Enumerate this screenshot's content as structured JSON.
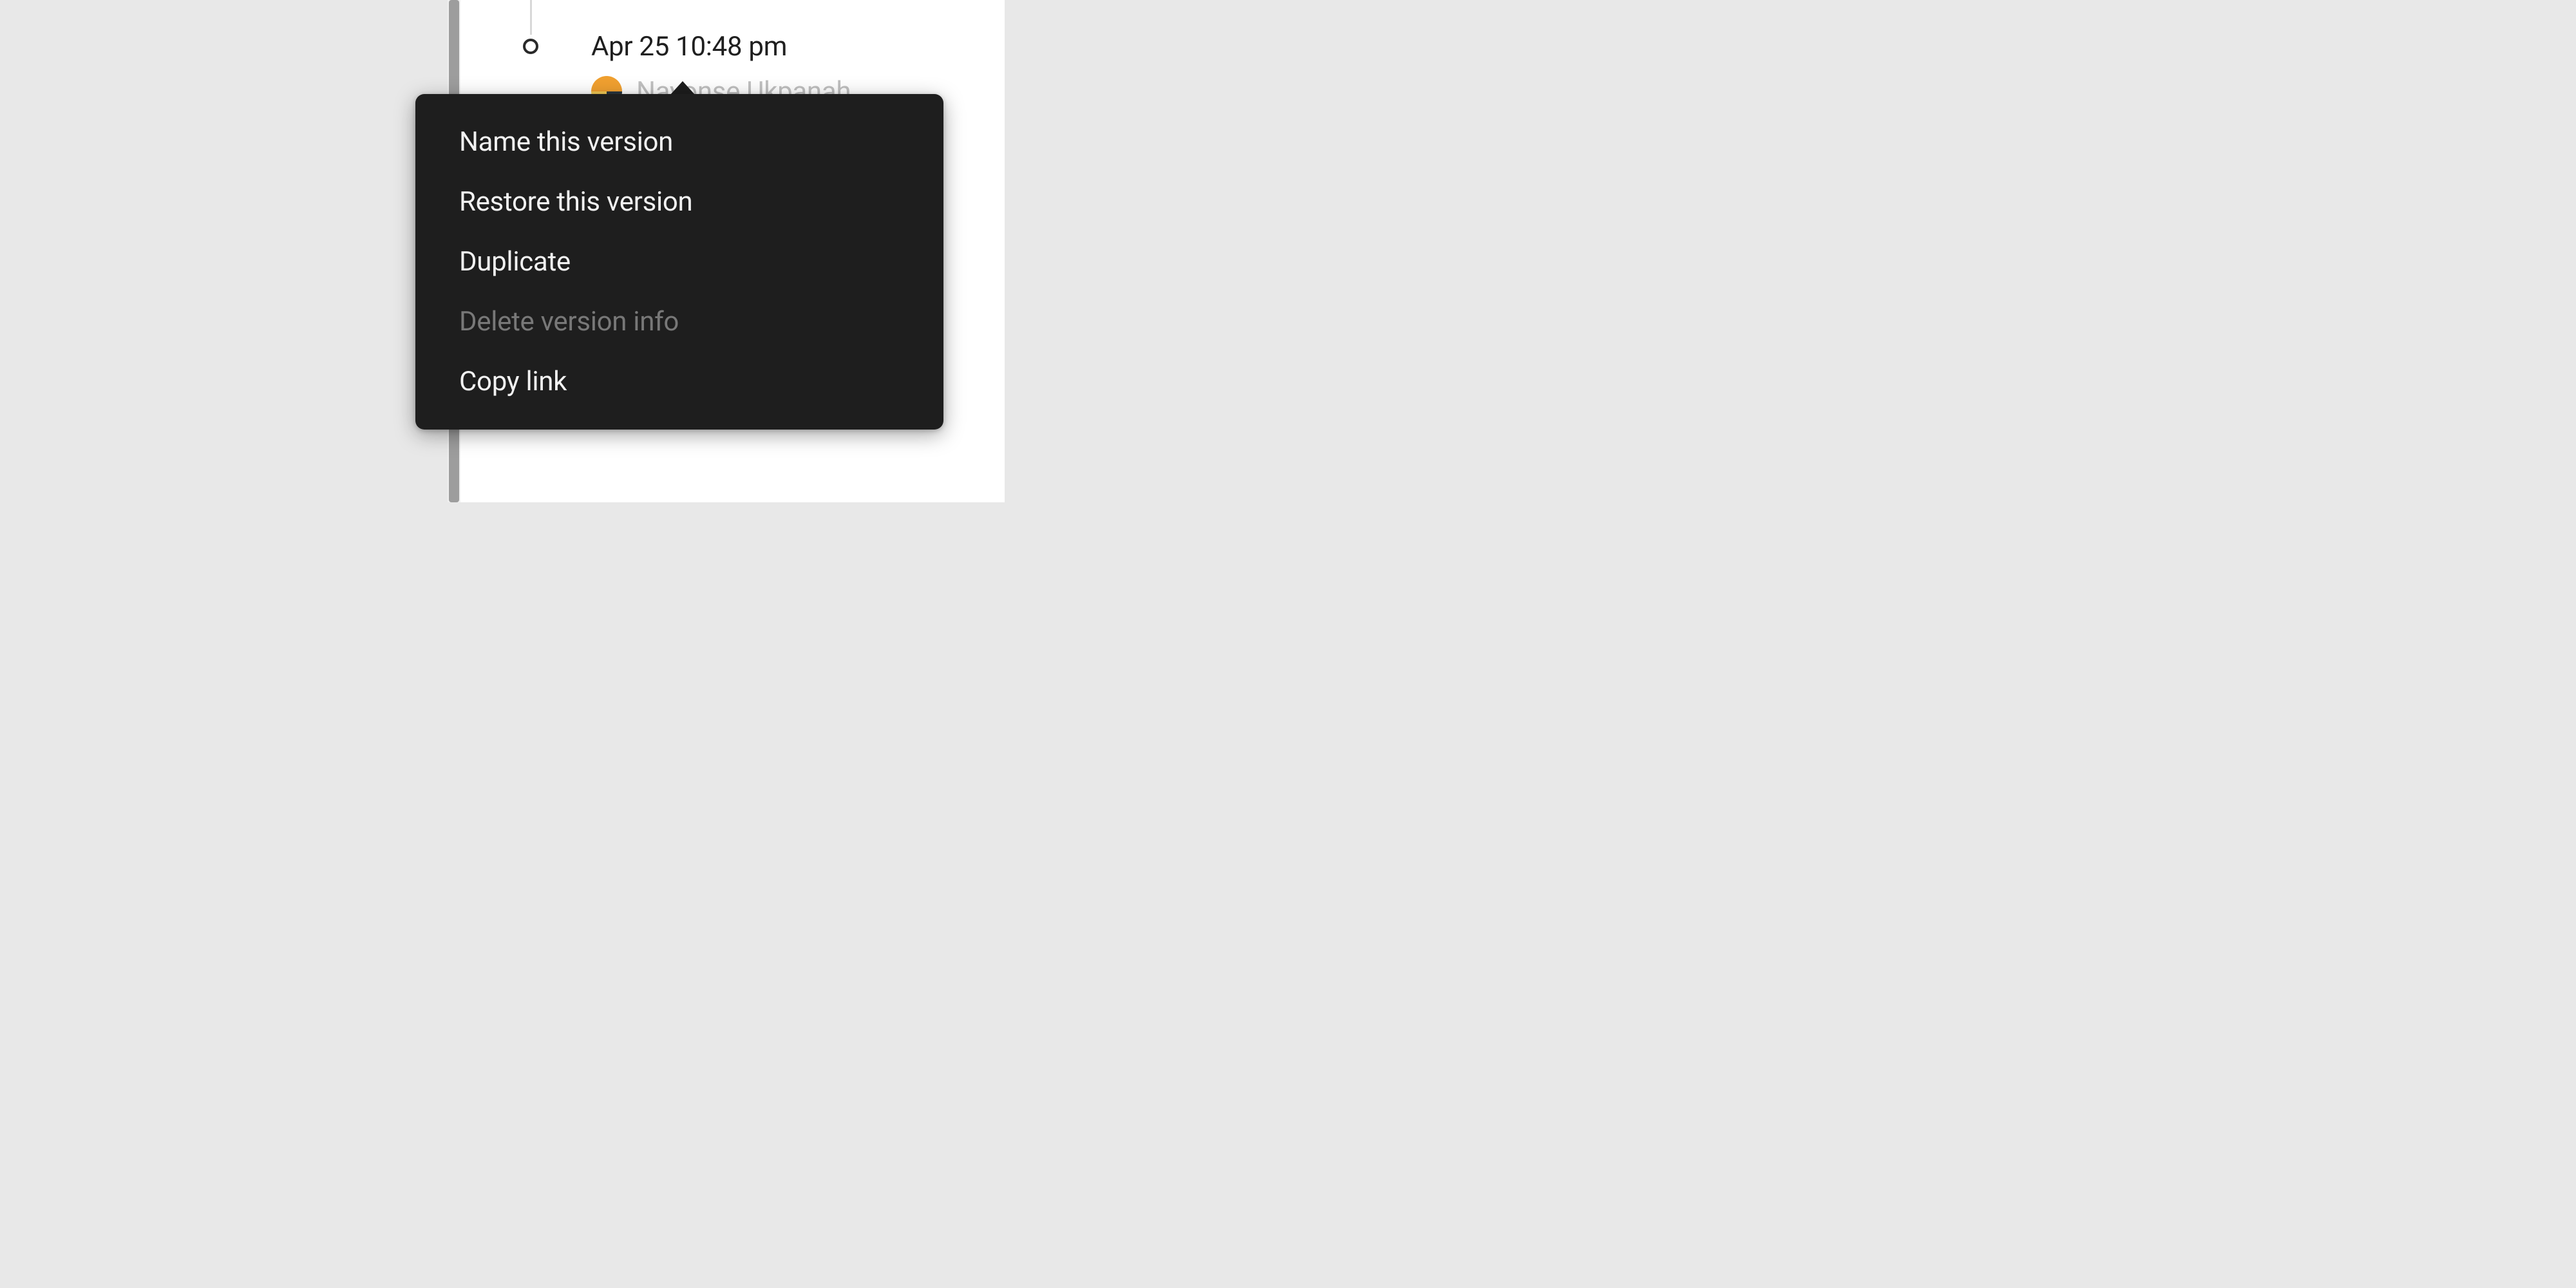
{
  "version": {
    "timestamp": "Apr 25 10:48 pm",
    "author": "Nayonse Ukpanah"
  },
  "context_menu": {
    "items": [
      {
        "label": "Name this version",
        "disabled": false
      },
      {
        "label": "Restore this version",
        "disabled": false
      },
      {
        "label": "Duplicate",
        "disabled": false
      },
      {
        "label": "Delete version info",
        "disabled": true
      },
      {
        "label": "Copy link",
        "disabled": false
      }
    ]
  }
}
